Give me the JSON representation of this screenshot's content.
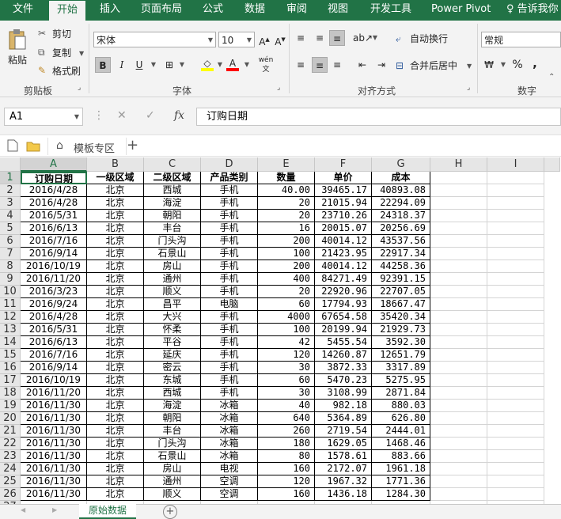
{
  "ribbon": {
    "tabs": [
      "文件",
      "开始",
      "插入",
      "页面布局",
      "公式",
      "数据",
      "审阅",
      "视图",
      "开发工具",
      "Power Pivot"
    ],
    "tell_me": "告诉我你",
    "clipboard": {
      "paste": "粘贴",
      "cut": "剪切",
      "copy": "复制",
      "format_painter": "格式刷",
      "group": "剪贴板"
    },
    "font": {
      "name": "宋体",
      "size": "10",
      "bold": "B",
      "italic": "I",
      "underline": "U",
      "phonetic": "wén",
      "group": "字体"
    },
    "alignment": {
      "wrap": "自动换行",
      "merge": "合并后居中",
      "group": "对齐方式"
    },
    "number": {
      "format": "常规",
      "percent": "%",
      "comma": ",",
      "group": "数字"
    }
  },
  "formula_bar": {
    "cell_ref": "A1",
    "fx": "fx",
    "cancel": "✕",
    "enter": "✓",
    "content": "订购日期"
  },
  "doc_bar": {
    "template_tab": "模板专区",
    "add": "+"
  },
  "columns": [
    "A",
    "B",
    "C",
    "D",
    "E",
    "F",
    "G",
    "H",
    "I"
  ],
  "row_numbers": [
    "1",
    "2",
    "3",
    "4",
    "5",
    "6",
    "7",
    "8",
    "9",
    "10",
    "11",
    "12",
    "13",
    "14",
    "15",
    "16",
    "17",
    "18",
    "19",
    "20",
    "21",
    "22",
    "23",
    "24",
    "25",
    "26",
    "27"
  ],
  "headers": [
    "订购日期",
    "一级区域",
    "二级区域",
    "产品类别",
    "数量",
    "单价",
    "成本"
  ],
  "rows": [
    [
      "2016/4/28",
      "北京",
      "西城",
      "手机",
      "40.00",
      "39465.17",
      "40893.08"
    ],
    [
      "2016/4/28",
      "北京",
      "海淀",
      "手机",
      "20",
      "21015.94",
      "22294.09"
    ],
    [
      "2016/5/31",
      "北京",
      "朝阳",
      "手机",
      "20",
      "23710.26",
      "24318.37"
    ],
    [
      "2016/6/13",
      "北京",
      "丰台",
      "手机",
      "16",
      "20015.07",
      "20256.69"
    ],
    [
      "2016/7/16",
      "北京",
      "门头沟",
      "手机",
      "200",
      "40014.12",
      "43537.56"
    ],
    [
      "2016/9/14",
      "北京",
      "石景山",
      "手机",
      "100",
      "21423.95",
      "22917.34"
    ],
    [
      "2016/10/19",
      "北京",
      "房山",
      "手机",
      "200",
      "40014.12",
      "44258.36"
    ],
    [
      "2016/11/20",
      "北京",
      "通州",
      "手机",
      "400",
      "84271.49",
      "92391.15"
    ],
    [
      "2016/3/23",
      "北京",
      "顺义",
      "手机",
      "20",
      "22920.96",
      "22707.05"
    ],
    [
      "2016/9/24",
      "北京",
      "昌平",
      "电脑",
      "60",
      "17794.93",
      "18667.47"
    ],
    [
      "2016/4/28",
      "北京",
      "大兴",
      "手机",
      "4000",
      "67654.58",
      "35420.34"
    ],
    [
      "2016/5/31",
      "北京",
      "怀柔",
      "手机",
      "100",
      "20199.94",
      "21929.73"
    ],
    [
      "2016/6/13",
      "北京",
      "平谷",
      "手机",
      "42",
      "5455.54",
      "3592.30"
    ],
    [
      "2016/7/16",
      "北京",
      "延庆",
      "手机",
      "120",
      "14260.87",
      "12651.79"
    ],
    [
      "2016/9/14",
      "北京",
      "密云",
      "手机",
      "30",
      "3872.33",
      "3317.89"
    ],
    [
      "2016/10/19",
      "北京",
      "东城",
      "手机",
      "60",
      "5470.23",
      "5275.95"
    ],
    [
      "2016/11/20",
      "北京",
      "西城",
      "手机",
      "30",
      "3108.99",
      "2871.84"
    ],
    [
      "2016/11/30",
      "北京",
      "海淀",
      "冰箱",
      "40",
      "982.18",
      "880.03"
    ],
    [
      "2016/11/30",
      "北京",
      "朝阳",
      "冰箱",
      "640",
      "5364.89",
      "626.80"
    ],
    [
      "2016/11/30",
      "北京",
      "丰台",
      "冰箱",
      "260",
      "2719.54",
      "2444.01"
    ],
    [
      "2016/11/30",
      "北京",
      "门头沟",
      "冰箱",
      "180",
      "1629.05",
      "1468.46"
    ],
    [
      "2016/11/30",
      "北京",
      "石景山",
      "冰箱",
      "80",
      "1578.61",
      "883.66"
    ],
    [
      "2016/11/30",
      "北京",
      "房山",
      "电视",
      "160",
      "2172.07",
      "1961.18"
    ],
    [
      "2016/11/30",
      "北京",
      "通州",
      "空调",
      "120",
      "1967.32",
      "1771.36"
    ],
    [
      "2016/11/30",
      "北京",
      "顺义",
      "空调",
      "160",
      "1436.18",
      "1284.30"
    ]
  ],
  "sheet_tabs": {
    "active": "原始数据",
    "add": "+"
  }
}
